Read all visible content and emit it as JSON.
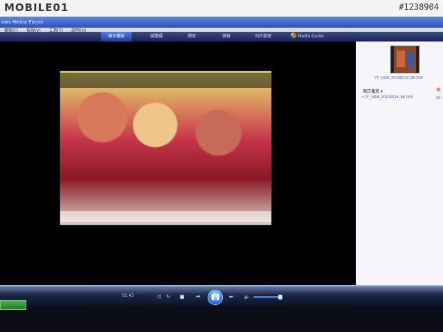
{
  "photo": {
    "brand": "MOBILE01",
    "watermark": "#1238904"
  },
  "window": {
    "title": "ows Media Player"
  },
  "menu": {
    "items": [
      "檔案(F)",
      "檢視(V)",
      "工具(T)",
      "說明(H)"
    ]
  },
  "tabs": [
    {
      "label": "現正播放",
      "active": true
    },
    {
      "label": "媒體櫃",
      "active": false
    },
    {
      "label": "擷取",
      "active": false
    },
    {
      "label": "燒錄",
      "active": false
    },
    {
      "label": "同步處理",
      "active": false
    },
    {
      "label": "Media Guide",
      "active": false
    }
  ],
  "playlist": {
    "art_caption": "CF_1608_20100514_BK 005",
    "label": "現正播放",
    "items": [
      {
        "title": "CF_1608_20100514_BK 005",
        "duration": "10:"
      }
    ]
  },
  "player": {
    "elapsed": "01:43",
    "volume_fraction": 0.75
  },
  "icons": {
    "shuffle": "shuffle-icon",
    "repeat": "repeat-icon",
    "stop": "stop-icon",
    "prev": "previous-icon",
    "play": "pause-icon",
    "next": "next-icon",
    "mute": "speaker-icon"
  },
  "colors": {
    "accent": "#2d7ae0",
    "tab_active": "#4f7ee8",
    "link": "#2f5fb8"
  }
}
